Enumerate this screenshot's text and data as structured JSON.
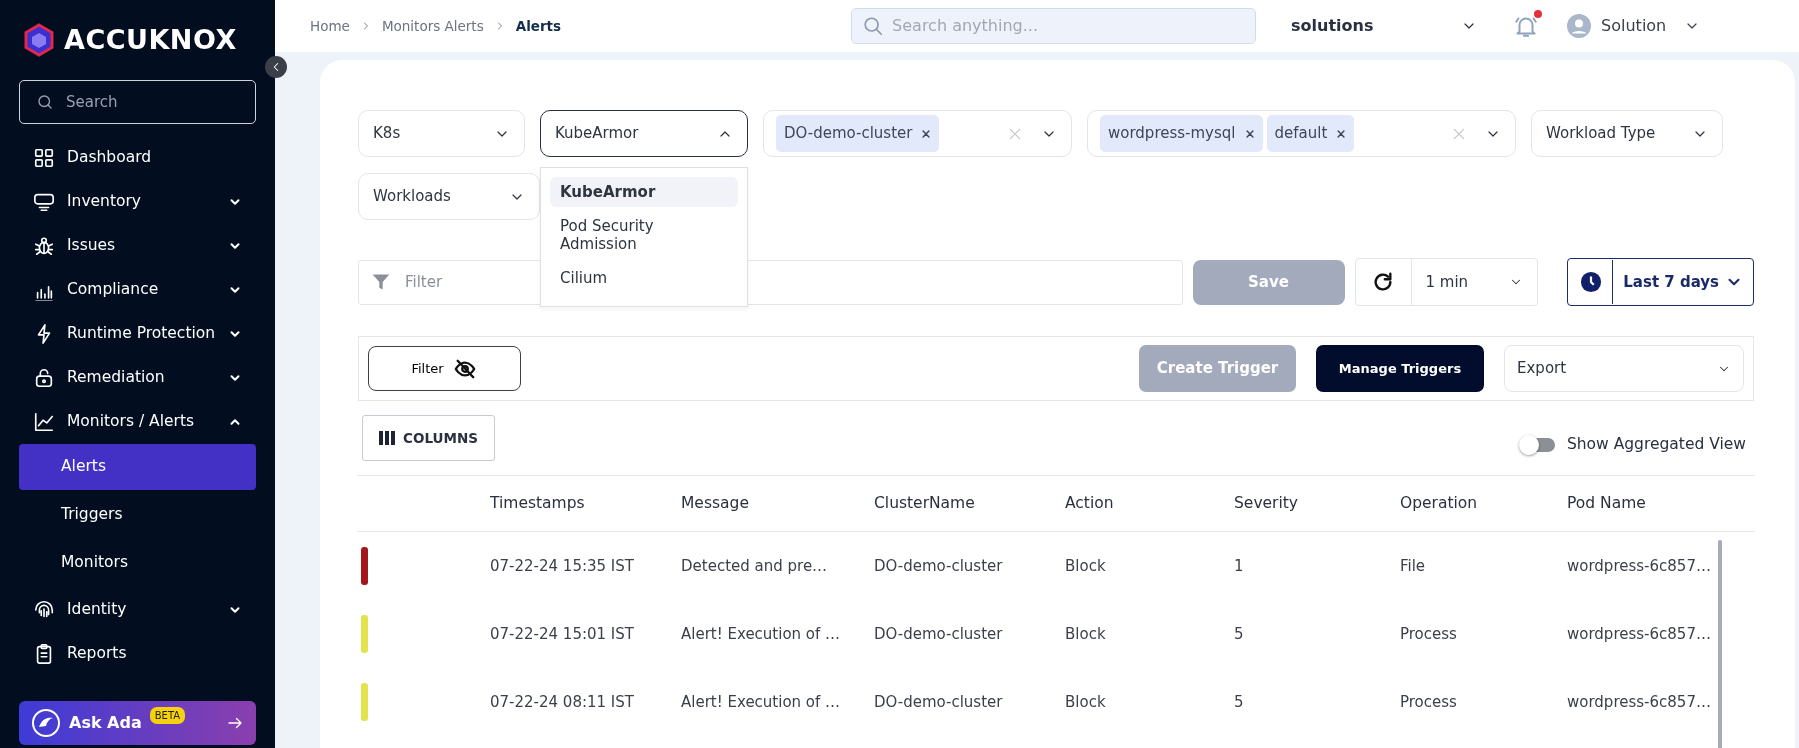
{
  "sidebar": {
    "logo": "ACCUKNOX",
    "search": {
      "placeholder": "Search"
    },
    "items": [
      {
        "kind": "link",
        "label": "Dashboard"
      },
      {
        "kind": "group",
        "label": "Inventory",
        "expanded": false
      },
      {
        "kind": "group",
        "label": "Issues",
        "expanded": false
      },
      {
        "kind": "group",
        "label": "Compliance",
        "expanded": false
      },
      {
        "kind": "group",
        "label": "Runtime Protection",
        "expanded": false
      },
      {
        "kind": "group",
        "label": "Remediation",
        "expanded": false
      },
      {
        "kind": "group",
        "label": "Monitors / Alerts",
        "expanded": true,
        "children": [
          {
            "label": "Alerts",
            "selected": true
          },
          {
            "label": "Triggers",
            "selected": false
          },
          {
            "label": "Monitors",
            "selected": false
          }
        ]
      },
      {
        "kind": "group",
        "label": "Identity",
        "expanded": false
      },
      {
        "kind": "link",
        "label": "Reports"
      }
    ],
    "assistant": {
      "label": "Ask Ada",
      "badge": "BETA"
    }
  },
  "topbar": {
    "breadcrumb": [
      "Home",
      "Monitors Alerts",
      "Alerts"
    ],
    "search": {
      "placeholder": "Search anything..."
    },
    "workspace": "solutions",
    "notifications_unread": true,
    "user": "Solution"
  },
  "filters": [
    {
      "kind": "select",
      "value": "K8s",
      "open": false
    },
    {
      "kind": "select",
      "value": "KubeArmor",
      "open": true,
      "options": [
        {
          "label": "KubeArmor",
          "selected": true
        },
        {
          "label": "Pod Security Admission",
          "selected": false
        },
        {
          "label": "Cilium",
          "selected": false
        }
      ]
    },
    {
      "kind": "multi",
      "tags": [
        "DO-demo-cluster"
      ]
    },
    {
      "kind": "multi",
      "tags": [
        "wordpress-mysql",
        "default"
      ]
    },
    {
      "kind": "select",
      "value": "Workload Type",
      "open": false
    },
    {
      "kind": "select",
      "value": "Workloads",
      "open": false
    }
  ],
  "query": {
    "placeholder": "Filter",
    "save": {
      "label": "Save",
      "disabled": true
    },
    "refresh_interval": "1 min",
    "time_range": "Last 7 days"
  },
  "toolbar": {
    "filter_toggle": "Filter",
    "create_trigger": {
      "label": "Create Trigger",
      "disabled": true
    },
    "manage_triggers": "Manage Triggers",
    "export": "Export"
  },
  "columns_button": "COLUMNS",
  "aggregated_view": {
    "label": "Show Aggregated View",
    "on": false
  },
  "table": {
    "columns": [
      "Timestamps",
      "Message",
      "ClusterName",
      "Action",
      "Severity",
      "Operation",
      "Pod Name"
    ],
    "rows": [
      {
        "color": "#a3161b",
        "cells": [
          "07-22-24 15:35 IST",
          "Detected and pre…",
          "DO-demo-cluster",
          "Block",
          "1",
          "File",
          "wordpress-6c857…"
        ]
      },
      {
        "color": "#e3e34e",
        "cells": [
          "07-22-24 15:01 IST",
          "Alert! Execution of …",
          "DO-demo-cluster",
          "Block",
          "5",
          "Process",
          "wordpress-6c857…"
        ]
      },
      {
        "color": "#e3e34e",
        "cells": [
          "07-22-24 08:11 IST",
          "Alert! Execution of …",
          "DO-demo-cluster",
          "Block",
          "5",
          "Process",
          "wordpress-6c857…"
        ]
      }
    ]
  }
}
